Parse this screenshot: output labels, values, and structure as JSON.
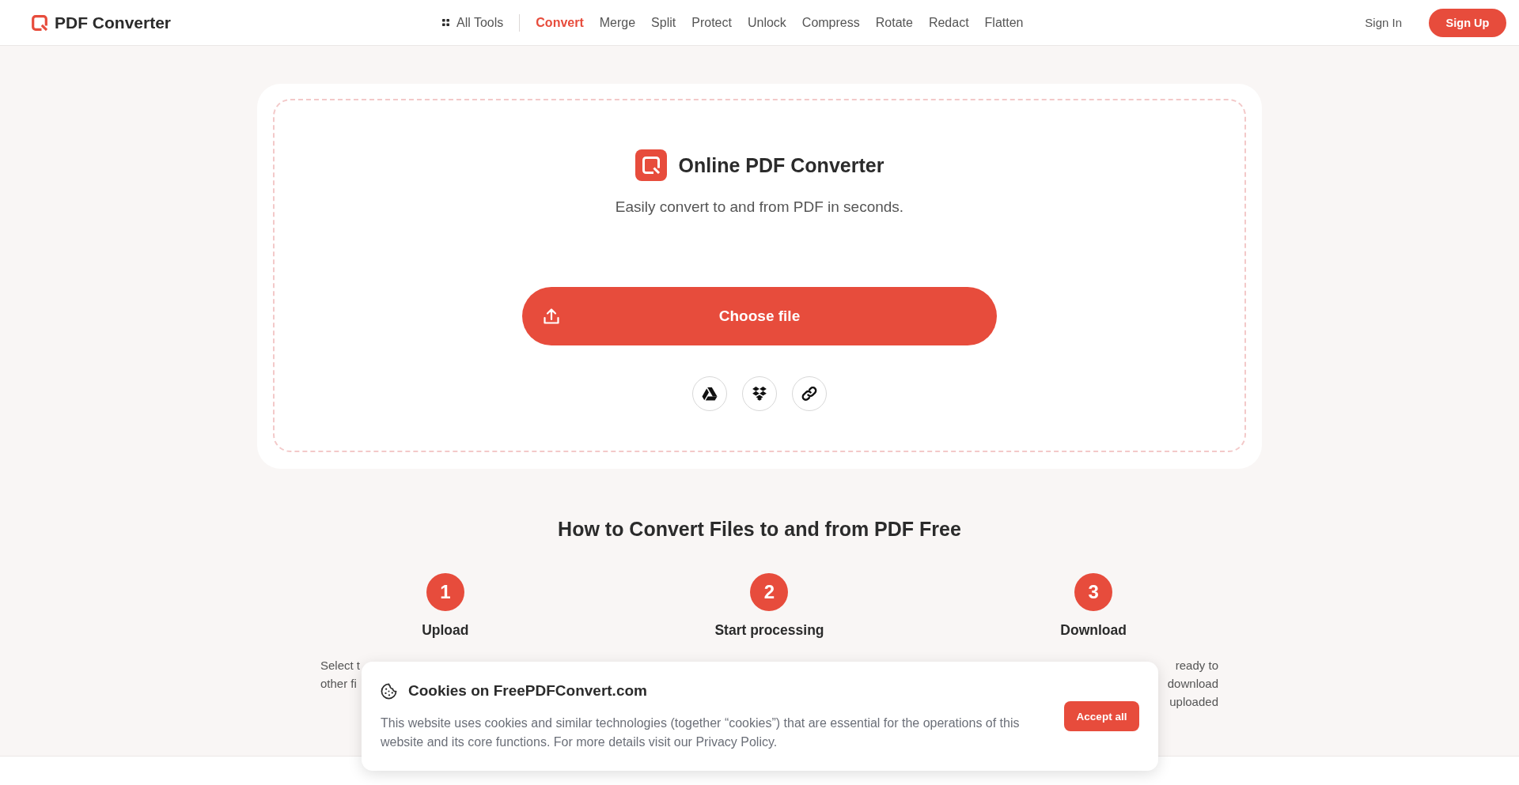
{
  "header": {
    "brand": "PDF Converter",
    "nav": [
      {
        "label": "All Tools",
        "kind": "menu",
        "selected": false
      },
      {
        "label": "Convert",
        "kind": "tool",
        "selected": true
      },
      {
        "label": "Merge",
        "kind": "tool",
        "selected": false
      },
      {
        "label": "Split",
        "kind": "tool",
        "selected": false
      },
      {
        "label": "Protect",
        "kind": "tool",
        "selected": false
      },
      {
        "label": "Unlock",
        "kind": "tool",
        "selected": false
      },
      {
        "label": "Compress",
        "kind": "tool",
        "selected": false
      },
      {
        "label": "Rotate",
        "kind": "tool",
        "selected": false
      },
      {
        "label": "Redact",
        "kind": "tool",
        "selected": false
      },
      {
        "label": "Flatten",
        "kind": "tool",
        "selected": false
      }
    ],
    "sign_in": "Sign In",
    "sign_up": "Sign Up"
  },
  "converter_card": {
    "title": "Online PDF Converter",
    "subtitle": "Easily convert to and from PDF in seconds.",
    "choose_file": "Choose file"
  },
  "how_to": {
    "title": "How to Convert Files to and from PDF Free",
    "steps": [
      {
        "number": "1",
        "title": "Upload",
        "description_lines": [
          "Select t",
          "other fi"
        ]
      },
      {
        "number": "2",
        "title": "Start processing"
      },
      {
        "number": "3",
        "title": "Download",
        "description_lines": [
          "ready to",
          "download",
          "uploaded"
        ]
      }
    ]
  },
  "cookie_banner": {
    "title": "Cookies on FreePDFConvert.com",
    "text": "This website uses cookies and similar technologies (together “cookies”) that are essential for the operations of this website and its core functions. For more details visit our Privacy Policy.",
    "accept": "Accept all"
  }
}
